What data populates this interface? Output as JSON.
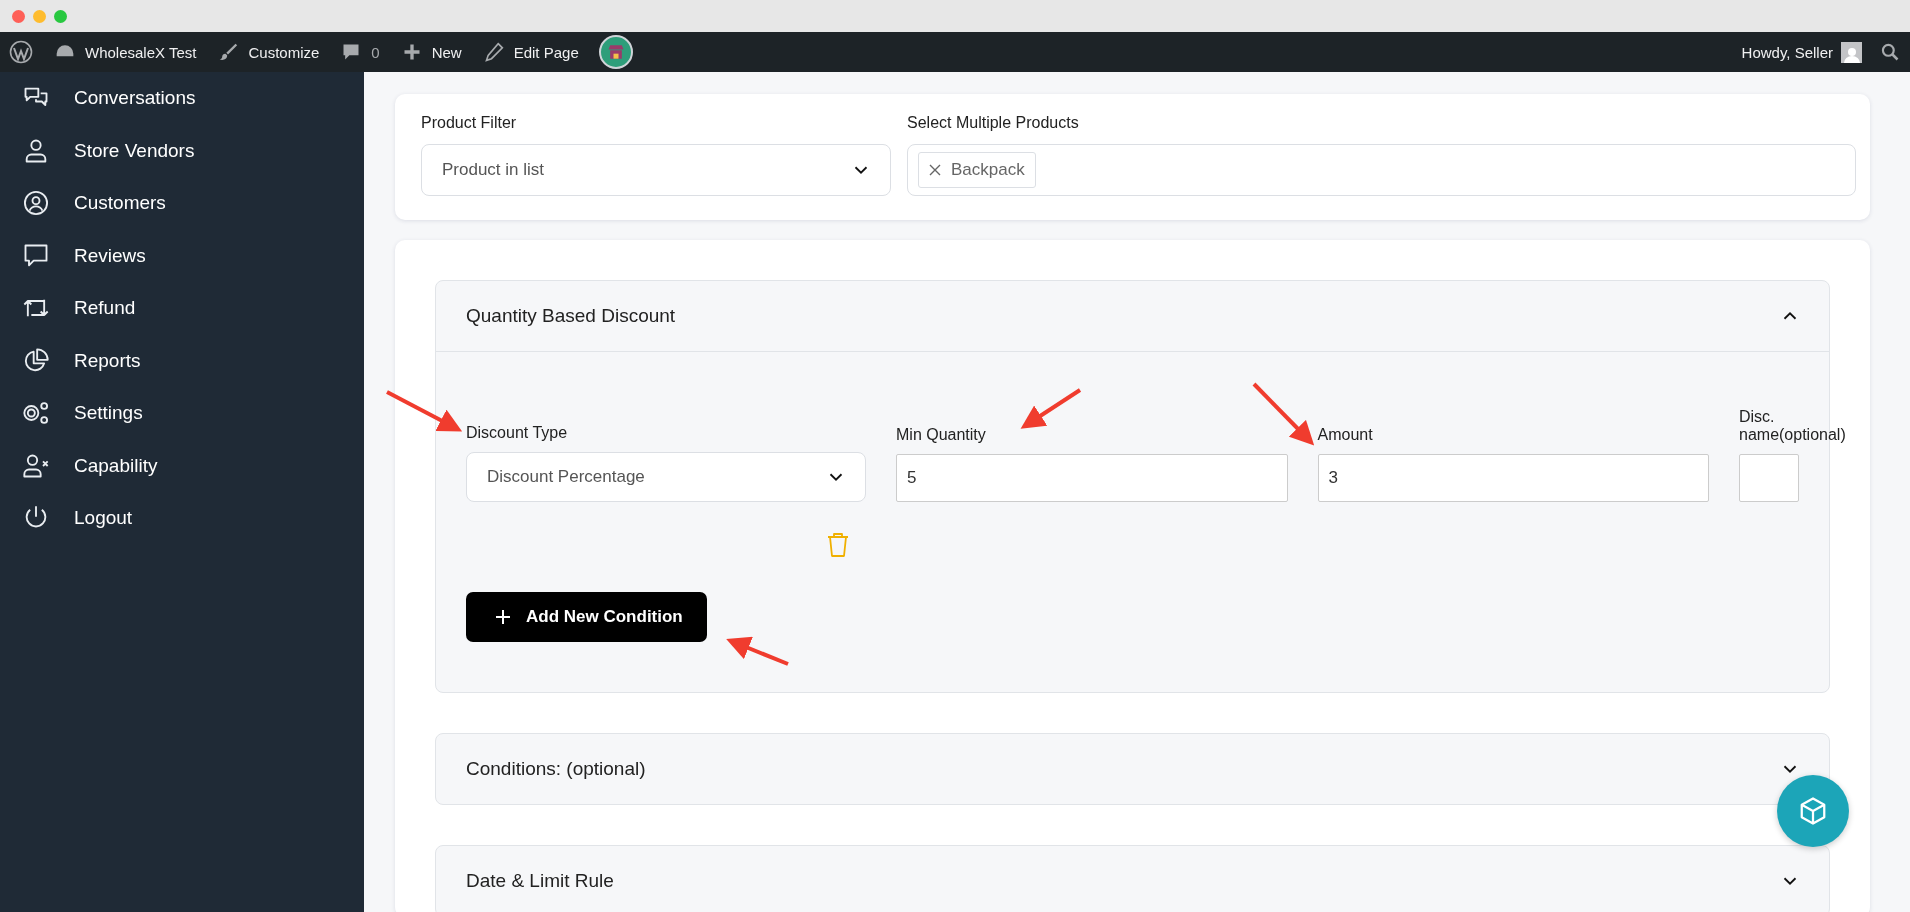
{
  "admin_bar": {
    "site": "WholesaleX Test",
    "customize": "Customize",
    "comments": "0",
    "new": "New",
    "edit": "Edit Page",
    "greeting": "Howdy, Seller"
  },
  "sidebar": {
    "items": [
      {
        "label": "Conversations"
      },
      {
        "label": "Store Vendors"
      },
      {
        "label": "Customers"
      },
      {
        "label": "Reviews"
      },
      {
        "label": "Refund"
      },
      {
        "label": "Reports"
      },
      {
        "label": "Settings"
      },
      {
        "label": "Capability"
      },
      {
        "label": "Logout"
      }
    ]
  },
  "product_filter": {
    "filter_label": "Product Filter",
    "filter_value": "Product in list",
    "products_label": "Select Multiple Products",
    "products": [
      "Backpack"
    ]
  },
  "accordions": [
    {
      "title": "Quantity Based Discount",
      "expanded": true,
      "fields": [
        {
          "kind": "select",
          "label": "Discount Type",
          "value": "Discount Percentage"
        },
        {
          "kind": "input",
          "label": "Min Quantity",
          "value": "5"
        },
        {
          "kind": "input",
          "label": "Amount",
          "value": "3"
        },
        {
          "kind": "input",
          "label": "Disc. name(optional)"
        }
      ],
      "button": "Add New Condition"
    },
    {
      "title": "Conditions: (optional)",
      "expanded": false
    },
    {
      "title": "Date & Limit Rule",
      "expanded": false
    }
  ]
}
